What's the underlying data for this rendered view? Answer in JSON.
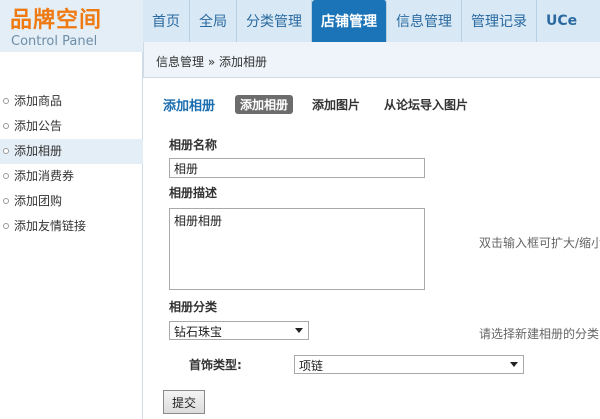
{
  "header": {
    "logo_title": "品牌空间",
    "logo_sub": "Control Panel",
    "nav": [
      {
        "label": "首页"
      },
      {
        "label": "全局"
      },
      {
        "label": "分类管理"
      },
      {
        "label": "店铺管理"
      },
      {
        "label": "信息管理"
      },
      {
        "label": "管理记录"
      },
      {
        "label": "UCe"
      }
    ],
    "active_nav": "店铺管理"
  },
  "breadcrumb": "信息管理 » 添加相册",
  "sidebar": {
    "items": [
      {
        "label": "添加商品"
      },
      {
        "label": "添加公告"
      },
      {
        "label": "添加相册"
      },
      {
        "label": "添加消费券"
      },
      {
        "label": "添加团购"
      },
      {
        "label": "添加友情链接"
      }
    ],
    "active": "添加相册"
  },
  "main": {
    "page_title": "添加相册",
    "tabs": [
      {
        "label": "添加相册"
      },
      {
        "label": "添加图片"
      },
      {
        "label": "从论坛导入图片"
      }
    ],
    "name_label": "相册名称",
    "name_value": "相册",
    "desc_label": "相册描述",
    "desc_value": "相册相册",
    "desc_hint": "双击输入框可扩大/缩小",
    "category_label": "相册分类",
    "category_value": "钻石珠宝",
    "category_hint": "请选择新建相册的分类",
    "jewelry_label": "首饰类型:",
    "jewelry_value": "项链",
    "submit_label": "提交"
  },
  "colors": {
    "accent": "#1b74b8",
    "logo": "#f07a12",
    "active_tab": "#6c6c6c"
  }
}
